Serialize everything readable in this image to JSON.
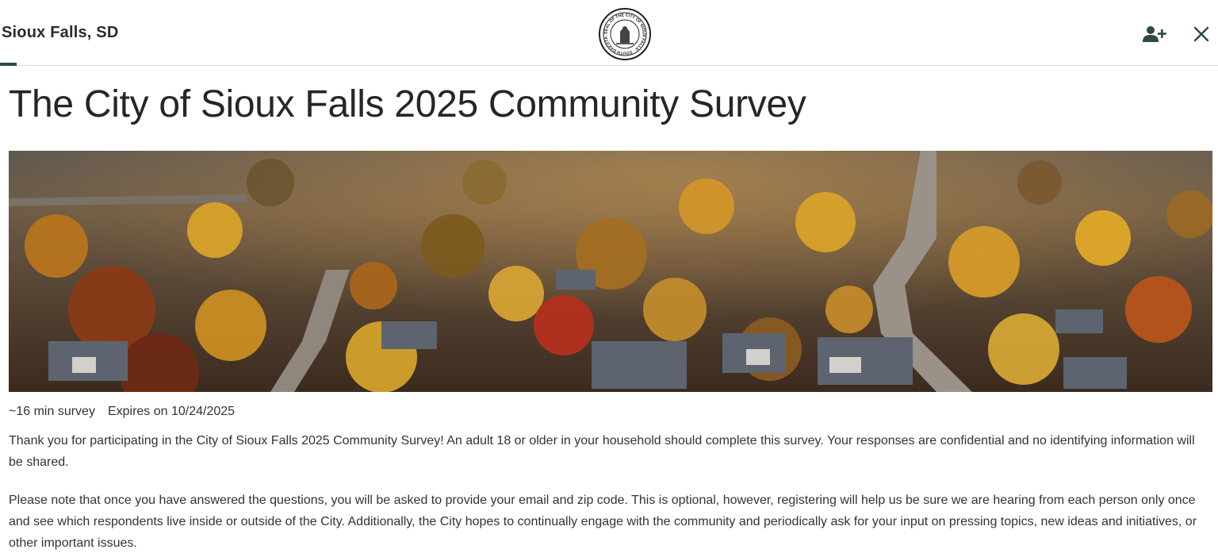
{
  "header": {
    "org_name": "Sioux Falls, SD",
    "seal_icon": "city-seal-logo",
    "seal_text": "SEAL OF THE CITY OF SIOUX FALLS · SOUTH DAKOTA",
    "add_user_icon": "add-user-icon",
    "close_icon": "close-icon"
  },
  "survey": {
    "title": "The City of Sioux Falls 2025 Community Survey",
    "duration": "~16 min survey",
    "expires": "Expires on 10/24/2025",
    "intro": "Thank you for participating in the City of Sioux Falls 2025 Community Survey! An adult 18 or older in your household should complete this survey. Your responses are confidential and no identifying information will be shared.",
    "note": "Please note that once you have answered the questions, you will be asked to provide your email and zip code. This is optional, however, registering will help us be sure we are hearing from each person only once and see which respondents live inside or outside of the City. Additionally, the City hopes to continually engage with the community and periodically ask for your input on pressing topics, new ideas and initiatives, or other important issues."
  },
  "colors": {
    "accent": "#2f4a42",
    "text": "#2b2b2b"
  }
}
